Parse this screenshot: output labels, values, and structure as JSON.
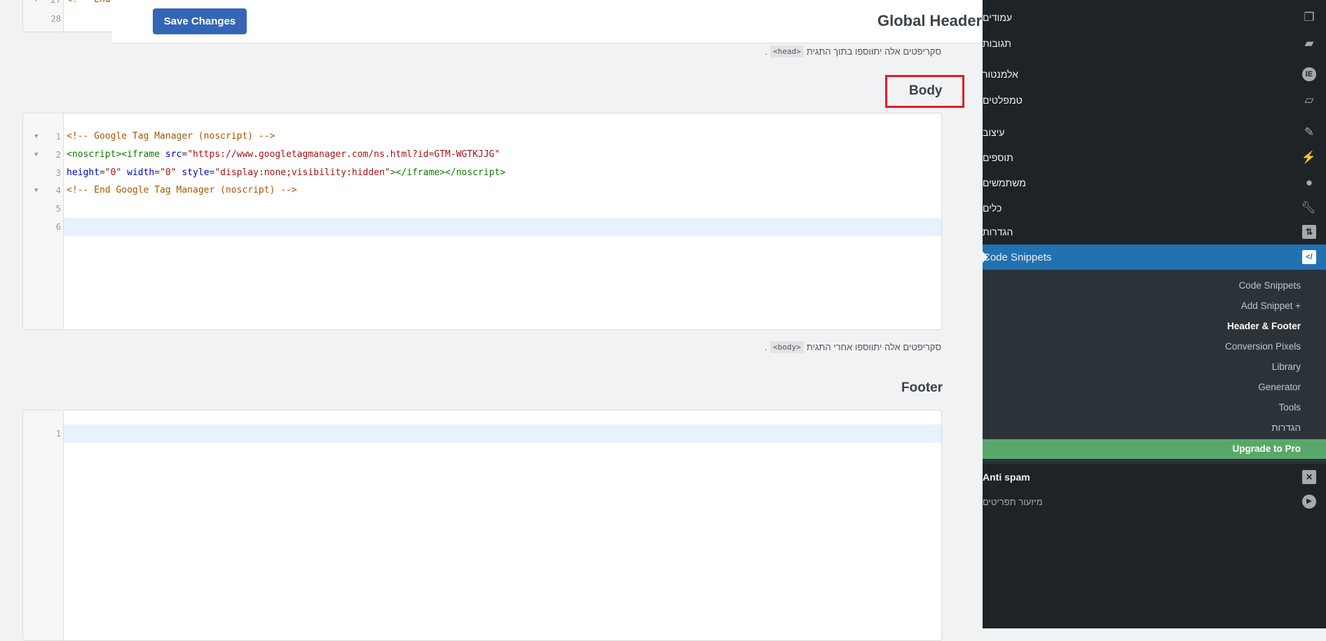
{
  "top_editor": {
    "lines": [
      {
        "num": "27",
        "text": "<!-- End"
      },
      {
        "num": "28",
        "text": ""
      }
    ]
  },
  "topbar": {
    "title": "Global Header",
    "save_label": "Save Changes"
  },
  "head_section": {
    "description": "סקריפטים אלה יתווספו בתוך התגית",
    "tag": "<head>",
    "suffix": "."
  },
  "body_section": {
    "title": "Body",
    "lines": [
      {
        "num": "1",
        "fold": true
      },
      {
        "num": "2",
        "fold": true
      },
      {
        "num": "3",
        "fold": false
      },
      {
        "num": "4",
        "fold": true
      },
      {
        "num": "5",
        "fold": false
      },
      {
        "num": "6",
        "fold": false
      }
    ],
    "code": {
      "l1": "<!-- Google Tag Manager (noscript) -->",
      "l2_tag": "<noscript><iframe",
      "l2_attr": " src",
      "l2_eq": "=",
      "l2_str": "\"https://www.googletagmanager.com/ns.html?id=GTM-WGTKJJG\"",
      "l3_a1": "height",
      "l3_s1": "\"0\"",
      "l3_a2": " width",
      "l3_s2": "\"0\"",
      "l3_a3": " style",
      "l3_s3": "\"display:none;visibility:hidden\"",
      "l3_tag": "></iframe></noscript>",
      "l4": "<!-- End Google Tag Manager (noscript) -->"
    },
    "description": "סקריפטים אלה יתווספו אחרי התגית",
    "tag": "<body>",
    "suffix": "."
  },
  "footer_section": {
    "title": "Footer",
    "lines": [
      {
        "num": "1"
      }
    ]
  },
  "sidebar": {
    "items": [
      {
        "label": "עמודים",
        "icon": "pages-icon"
      },
      {
        "label": "תגובות",
        "icon": "comments-icon"
      },
      {
        "label": "אלמנטור",
        "icon": "elementor-icon"
      },
      {
        "label": "טמפלטים",
        "icon": "folder-icon"
      },
      {
        "label": "עיצוב",
        "icon": "brush-icon"
      },
      {
        "label": "תוספים",
        "icon": "plugin-icon"
      },
      {
        "label": "משתמשים",
        "icon": "user-icon"
      },
      {
        "label": "כלים",
        "icon": "wrench-icon"
      },
      {
        "label": "הגדרות",
        "icon": "settings-icon"
      }
    ],
    "active": {
      "label": "Code Snippets",
      "icon": "code-icon",
      "color": "#2271b1"
    },
    "submenu": [
      "Code Snippets",
      "Add Snippet +",
      "Header & Footer",
      "Conversion Pixels",
      "Library",
      "Generator",
      "Tools",
      "הגדרות"
    ],
    "submenu_current": "Header & Footer",
    "upgrade": {
      "label": "Upgrade to Pro",
      "color": "#59a869"
    },
    "antispam": {
      "label": "Anti spam",
      "icon": "antispam-icon"
    },
    "collapse": {
      "label": "מיזעור תפריטים",
      "icon": "collapse-icon"
    }
  }
}
